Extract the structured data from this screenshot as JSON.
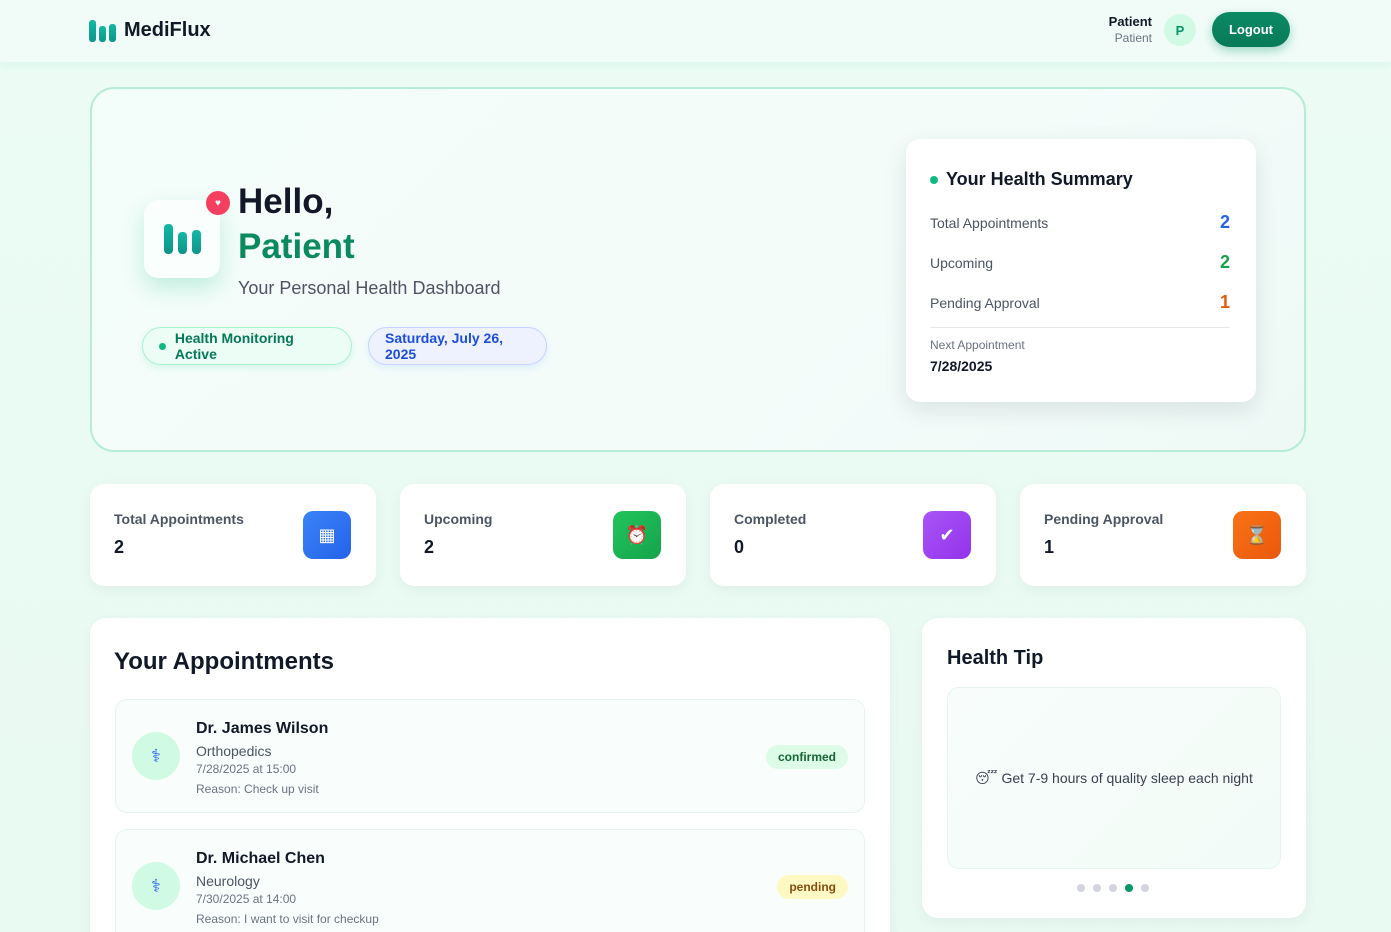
{
  "header": {
    "app_name": "MediFlux",
    "user_name": "Patient",
    "user_role": "Patient",
    "avatar_initial": "P",
    "logout_label": "Logout"
  },
  "hero": {
    "greeting": "Hello,",
    "name": "Patient",
    "subtitle": "Your Personal Health Dashboard",
    "status_pill": "Health Monitoring Active",
    "date_pill": "Saturday, July 26, 2025",
    "badge_icon": "heart-icon"
  },
  "summary": {
    "title": "Your Health Summary",
    "rows": [
      {
        "label": "Total Appointments",
        "value": "2",
        "color": "#2563eb"
      },
      {
        "label": "Upcoming",
        "value": "2",
        "color": "#16a34a"
      },
      {
        "label": "Pending Approval",
        "value": "1",
        "color": "#ea580c"
      }
    ],
    "next_label": "Next Appointment",
    "next_value": "7/28/2025"
  },
  "stats": [
    {
      "label": "Total Appointments",
      "value": "2",
      "icon": "calendar-icon",
      "glyph": "▦",
      "color": "#2563eb"
    },
    {
      "label": "Upcoming",
      "value": "2",
      "icon": "alarm-clock-icon",
      "glyph": "⏰",
      "color": "#16a34a"
    },
    {
      "label": "Completed",
      "value": "0",
      "icon": "check-box-icon",
      "glyph": "✔",
      "color": "#9333ea"
    },
    {
      "label": "Pending Approval",
      "value": "1",
      "icon": "hourglass-icon",
      "glyph": "⌛",
      "color": "#ea580c"
    }
  ],
  "appointments": {
    "title": "Your Appointments",
    "items": [
      {
        "doctor": "Dr. James Wilson",
        "specialty": "Orthopedics",
        "when": "7/28/2025 at 15:00",
        "reason": "Reason: Check up visit",
        "status": "confirmed"
      },
      {
        "doctor": "Dr. Michael Chen",
        "specialty": "Neurology",
        "when": "7/30/2025 at 14:00",
        "reason": "Reason: I want to visit for checkup",
        "status": "pending"
      }
    ]
  },
  "health_tip": {
    "title": "Health Tip",
    "tip": "😴 Get 7-9 hours of quality sleep each night",
    "dots_total": 5,
    "dots_active": 4
  }
}
